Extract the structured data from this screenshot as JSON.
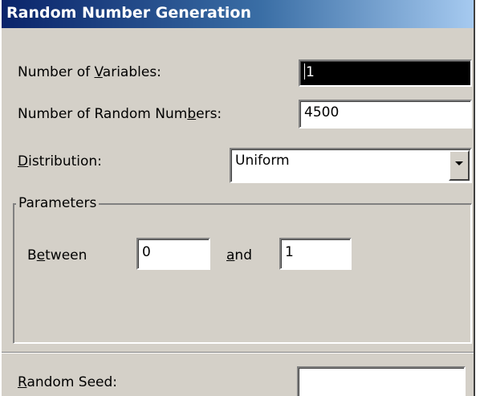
{
  "window": {
    "title": "Random Number Generation"
  },
  "form": {
    "num_variables": {
      "label_pre": "Number of ",
      "label_key": "V",
      "label_post": "ariables:",
      "value": "1"
    },
    "num_random_numbers": {
      "label_pre": "Number of Random Num",
      "label_key": "b",
      "label_post": "ers:",
      "value": "4500"
    },
    "distribution": {
      "label_pre": "",
      "label_key": "D",
      "label_post": "istribution:",
      "value": "Uniform"
    },
    "parameters": {
      "group_label": "Parameters",
      "between": {
        "label_pre": "B",
        "label_key": "e",
        "label_post": "tween",
        "value": "0"
      },
      "and": {
        "label_pre": "",
        "label_key": "a",
        "label_post": "nd",
        "value": "1"
      }
    },
    "random_seed": {
      "label_pre": "",
      "label_key": "R",
      "label_post": "andom Seed:",
      "value": ""
    }
  },
  "icons": {
    "dropdown_arrow": "chevron-down-icon"
  },
  "colors": {
    "title_start": "#0a246a",
    "title_end": "#a6caf0",
    "dialog_bg": "#d4d0c8",
    "selection_bg": "#000000"
  }
}
